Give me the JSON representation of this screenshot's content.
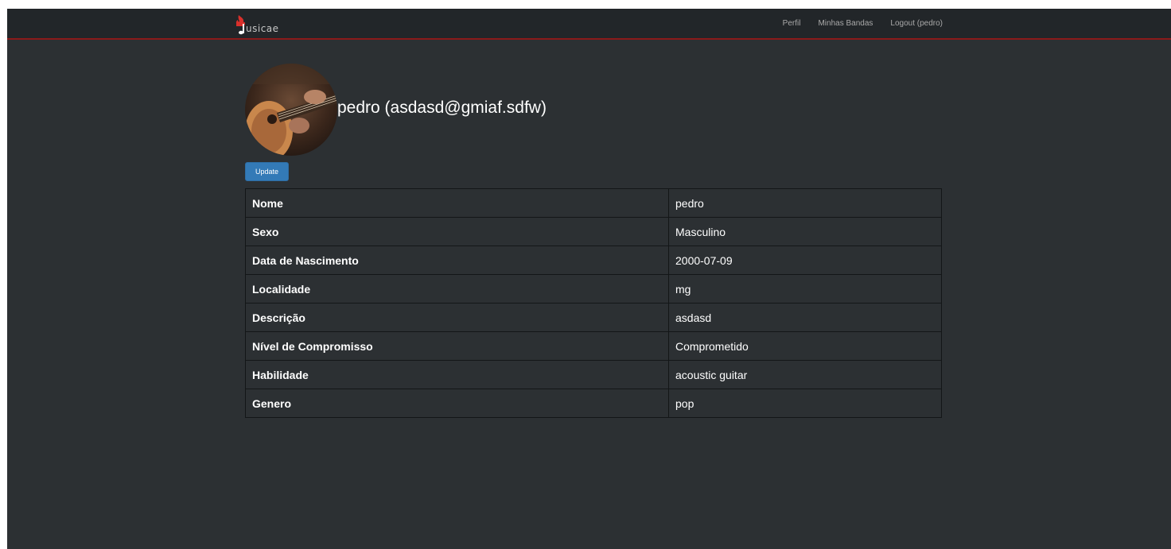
{
  "navbar": {
    "brand_text": "usicae",
    "links": [
      {
        "label": "Perfil"
      },
      {
        "label": "Minhas Bandas"
      },
      {
        "label": "Logout (pedro)"
      }
    ]
  },
  "profile": {
    "title": "pedro (asdasd@gmiaf.sdfw)",
    "update_label": "Update"
  },
  "details": [
    {
      "label": "Nome",
      "value": "pedro"
    },
    {
      "label": "Sexo",
      "value": "Masculino"
    },
    {
      "label": "Data de Nascimento",
      "value": "2000-07-09"
    },
    {
      "label": "Localidade",
      "value": "mg"
    },
    {
      "label": "Descrição",
      "value": "asdasd"
    },
    {
      "label": "Nível de Compromisso",
      "value": "Comprometido"
    },
    {
      "label": "Habilidade",
      "value": "acoustic guitar"
    },
    {
      "label": "Genero",
      "value": "pop"
    }
  ],
  "colors": {
    "background": "#2c3033",
    "navbar": "#222629",
    "navbar_border": "#8b1a1a",
    "button": "#337ab7",
    "brand_accent": "#d9302b"
  }
}
